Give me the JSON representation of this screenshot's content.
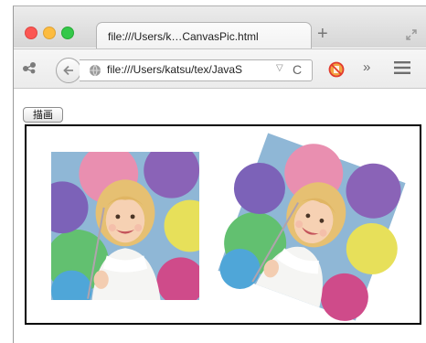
{
  "browser": {
    "tab_title": "file:///Users/k…CanvasPic.html",
    "new_tab_symbol": "+",
    "address": "file:///Users/katsu/tex/JavaS",
    "address_dropdown_symbol": "▽",
    "reload_symbol": "C",
    "overflow_symbol": "»",
    "icons": [
      "share-icon",
      "back-arrow-icon",
      "globe-icon",
      "reload-icon",
      "noscript-icon",
      "overflow-icon",
      "hamburger-menu-icon",
      "expand-icon"
    ]
  },
  "page": {
    "draw_button_label": "描画",
    "images": [
      {
        "name": "girl-with-balloons-photo",
        "rotation_deg": 0
      },
      {
        "name": "girl-with-balloons-photo-rotated",
        "rotation_deg": 20
      }
    ]
  },
  "colors": {
    "close": "#fc5753",
    "minimize": "#fdbc40",
    "zoom": "#34c84a",
    "canvas_border": "#000000"
  }
}
